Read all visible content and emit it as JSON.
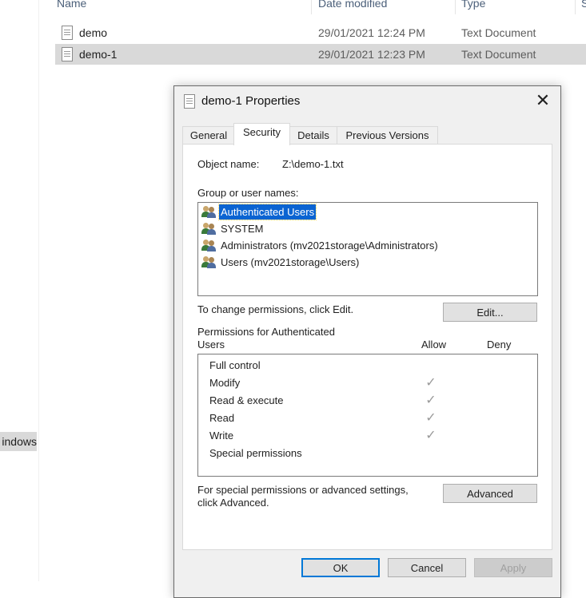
{
  "explorer": {
    "columns": {
      "name": "Name",
      "date_modified": "Date modified",
      "type": "Type",
      "size": "S"
    },
    "files": [
      {
        "name": "demo",
        "date": "29/01/2021 12:24 PM",
        "type": "Text Document",
        "selected": false
      },
      {
        "name": "demo-1",
        "date": "29/01/2021 12:23 PM",
        "type": "Text Document",
        "selected": true
      }
    ],
    "nav_leftover": "indows"
  },
  "dialog": {
    "title": "demo-1 Properties",
    "close_glyph": "✕",
    "tabs": [
      {
        "label": "General",
        "active": false
      },
      {
        "label": "Security",
        "active": true
      },
      {
        "label": "Details",
        "active": false
      },
      {
        "label": "Previous Versions",
        "active": false
      }
    ],
    "object_name_label": "Object name:",
    "object_name_value": "Z:\\demo-1.txt",
    "group_label": "Group or user names:",
    "groups": [
      {
        "label": "Authenticated Users",
        "selected": true
      },
      {
        "label": "SYSTEM",
        "selected": false
      },
      {
        "label": "Administrators (mv2021storage\\Administrators)",
        "selected": false
      },
      {
        "label": "Users (mv2021storage\\Users)",
        "selected": false
      }
    ],
    "change_permissions_text": "To change permissions, click Edit.",
    "edit_button": "Edit...",
    "permissions_for_line1": "Permissions for Authenticated",
    "permissions_for_line2": "Users",
    "allow_header": "Allow",
    "deny_header": "Deny",
    "permissions": [
      {
        "name": "Full control",
        "allow": false,
        "deny": false
      },
      {
        "name": "Modify",
        "allow": true,
        "deny": false
      },
      {
        "name": "Read & execute",
        "allow": true,
        "deny": false
      },
      {
        "name": "Read",
        "allow": true,
        "deny": false
      },
      {
        "name": "Write",
        "allow": true,
        "deny": false
      },
      {
        "name": "Special permissions",
        "allow": false,
        "deny": false
      }
    ],
    "check_glyph": "✓",
    "advanced_text_line1": "For special permissions or advanced settings,",
    "advanced_text_line2": "click Advanced.",
    "advanced_button": "Advanced",
    "ok_button": "OK",
    "cancel_button": "Cancel",
    "apply_button": "Apply"
  },
  "colors": {
    "selection": "#0a64d2",
    "row_selected": "#d9d9d9",
    "dialog_bg": "#f0f0f0",
    "focus_border": "#0078d7"
  }
}
